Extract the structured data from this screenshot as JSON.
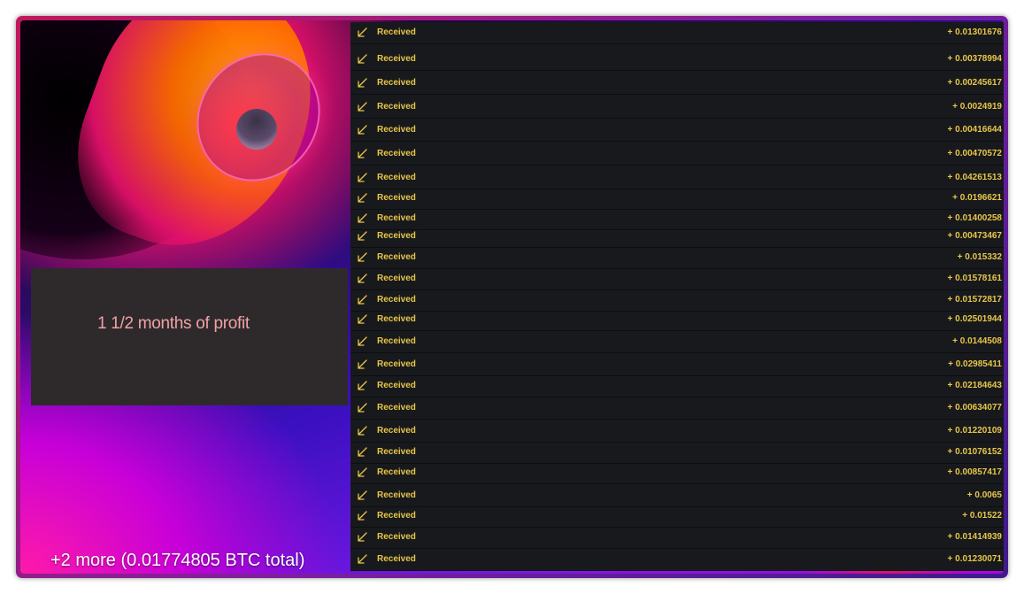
{
  "colors": {
    "accent": "#e8c64a",
    "list_bg": "#17191c",
    "caption_bg": "#2e2a2b",
    "caption_text": "#f2a0a8"
  },
  "caption": {
    "text": "1 1/2 months of profit"
  },
  "summary": {
    "text": "+2 more (0.01774805 BTC total)"
  },
  "transactions": [
    {
      "icon": "arrow-down-left-icon",
      "label": "Received",
      "amount": "+ 0.01301676"
    },
    {
      "icon": "arrow-down-left-icon",
      "label": "Received",
      "amount": "+ 0.00378994"
    },
    {
      "icon": "arrow-down-left-icon",
      "label": "Received",
      "amount": "+ 0.00245617"
    },
    {
      "icon": "arrow-down-left-icon",
      "label": "Received",
      "amount": "+ 0.0024919"
    },
    {
      "icon": "arrow-down-left-icon",
      "label": "Received",
      "amount": "+ 0.00416644"
    },
    {
      "icon": "arrow-down-left-icon",
      "label": "Received",
      "amount": "+ 0.00470572"
    },
    {
      "icon": "arrow-down-left-icon",
      "label": "Received",
      "amount": "+ 0.04261513"
    },
    {
      "icon": "arrow-down-left-icon",
      "label": "Received",
      "amount": "+ 0.0196621"
    },
    {
      "icon": "arrow-down-left-icon",
      "label": "Received",
      "amount": "+ 0.01400258"
    },
    {
      "icon": "arrow-down-left-icon",
      "label": "Received",
      "amount": "+ 0.00473467"
    },
    {
      "icon": "arrow-down-left-icon",
      "label": "Received",
      "amount": "+ 0.015332"
    },
    {
      "icon": "arrow-down-left-icon",
      "label": "Received",
      "amount": "+ 0.01578161"
    },
    {
      "icon": "arrow-down-left-icon",
      "label": "Received",
      "amount": "+ 0.01572817"
    },
    {
      "icon": "arrow-down-left-icon",
      "label": "Received",
      "amount": "+ 0.02501944"
    },
    {
      "icon": "arrow-down-left-icon",
      "label": "Received",
      "amount": "+ 0.0144508"
    },
    {
      "icon": "arrow-down-left-icon",
      "label": "Received",
      "amount": "+ 0.02985411"
    },
    {
      "icon": "arrow-down-left-icon",
      "label": "Received",
      "amount": "+ 0.02184643"
    },
    {
      "icon": "arrow-down-left-icon",
      "label": "Received",
      "amount": "+ 0.00634077"
    },
    {
      "icon": "arrow-down-left-icon",
      "label": "Received",
      "amount": "+ 0.01220109"
    },
    {
      "icon": "arrow-down-left-icon",
      "label": "Received",
      "amount": "+ 0.01076152"
    },
    {
      "icon": "arrow-down-left-icon",
      "label": "Received",
      "amount": "+ 0.00857417"
    },
    {
      "icon": "arrow-down-left-icon",
      "label": "Received",
      "amount": "+ 0.0065"
    },
    {
      "icon": "arrow-down-left-icon",
      "label": "Received",
      "amount": "+ 0.01522"
    },
    {
      "icon": "arrow-down-left-icon",
      "label": "Received",
      "amount": "+ 0.01414939"
    },
    {
      "icon": "arrow-down-left-icon",
      "label": "Received",
      "amount": "+ 0.01230071"
    }
  ]
}
